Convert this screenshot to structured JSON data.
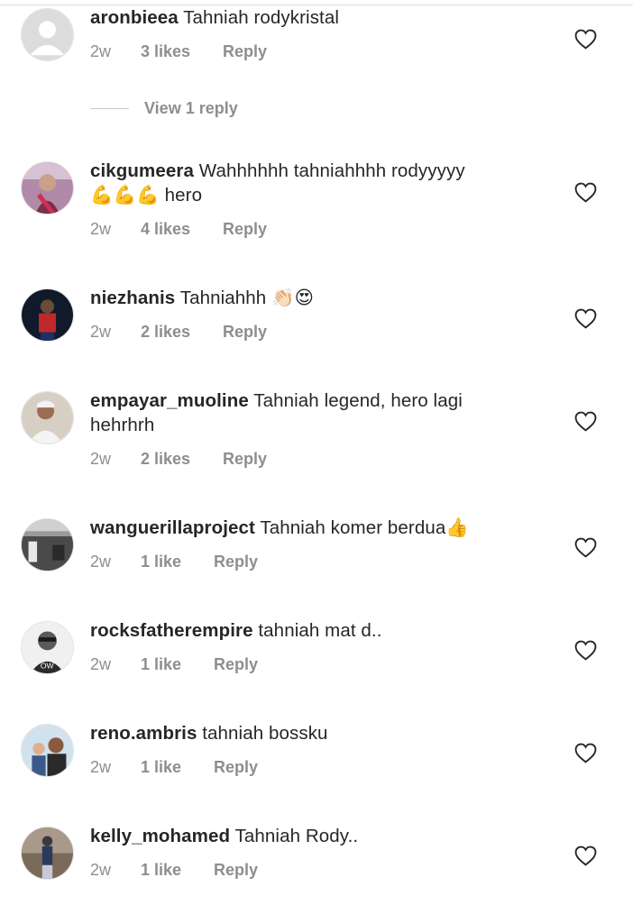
{
  "comments": [
    {
      "username": "aronbieea",
      "text": "Tahniah rodykristal",
      "time": "2w",
      "likes": "3 likes",
      "reply": "Reply",
      "view_reply": "View 1 reply"
    },
    {
      "username": "cikgumeera",
      "text": "Wahhhhhh tahniahhhh rodyyyyy",
      "text2": "💪💪💪 hero",
      "time": "2w",
      "likes": "4 likes",
      "reply": "Reply"
    },
    {
      "username": "niezhanis",
      "text": "Tahniahhh 👏🏻😍",
      "time": "2w",
      "likes": "2 likes",
      "reply": "Reply"
    },
    {
      "username": "empayar_muoline",
      "text": "Tahniah legend, hero lagi",
      "text2": "hehrhrh",
      "time": "2w",
      "likes": "2 likes",
      "reply": "Reply"
    },
    {
      "username": "wanguerillaproject",
      "text": "Tahniah komer berdua👍",
      "time": "2w",
      "likes": "1 like",
      "reply": "Reply"
    },
    {
      "username": "rocksfatherempire",
      "text": "tahniah mat d..",
      "time": "2w",
      "likes": "1 like",
      "reply": "Reply"
    },
    {
      "username": "reno.ambris",
      "text": "tahniah bossku",
      "time": "2w",
      "likes": "1 like",
      "reply": "Reply"
    },
    {
      "username": "kelly_mohamed",
      "text": "Tahniah Rody..",
      "time": "2w",
      "likes": "1 like",
      "reply": "Reply"
    }
  ],
  "icons": {
    "like": "heart-outline-icon",
    "avatar_default": "default-avatar-icon"
  },
  "colors": {
    "text": "#262626",
    "meta": "#8e8e8e",
    "divider": "#dbdbdb"
  }
}
